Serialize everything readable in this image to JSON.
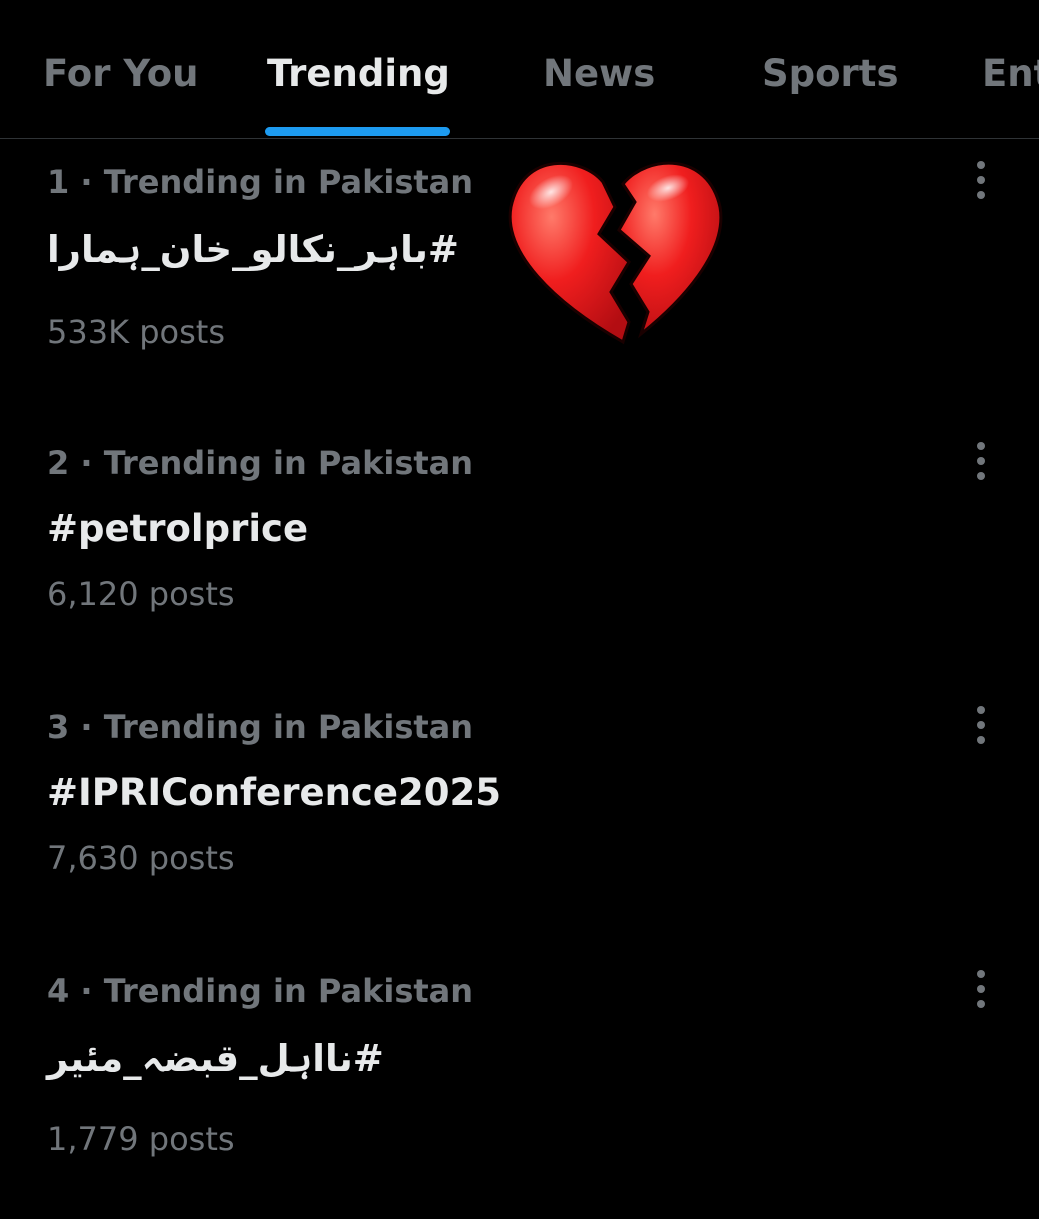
{
  "tabs": [
    {
      "label": "For You",
      "active": false
    },
    {
      "label": "Trending",
      "active": true
    },
    {
      "label": "News",
      "active": false
    },
    {
      "label": "Sports",
      "active": false
    },
    {
      "label": "Ent",
      "active": false
    }
  ],
  "accent_color": "#1d9bf0",
  "trends": [
    {
      "meta": "1 · Trending in Pakistan",
      "title": "#باہر_نکالو_خان_ہمارا",
      "count": "533K posts"
    },
    {
      "meta": "2 · Trending in Pakistan",
      "title": "#petrolprice",
      "count": "6,120 posts"
    },
    {
      "meta": "3 · Trending in Pakistan",
      "title": "#IPRIConference2025",
      "count": "7,630 posts"
    },
    {
      "meta": "4 · Trending in Pakistan",
      "title": "#نااہل_قبضہ_مئیر",
      "count": "1,779 posts"
    }
  ],
  "more_icon": "more-vertical-icon",
  "overlay_emoji": "broken-heart-icon"
}
